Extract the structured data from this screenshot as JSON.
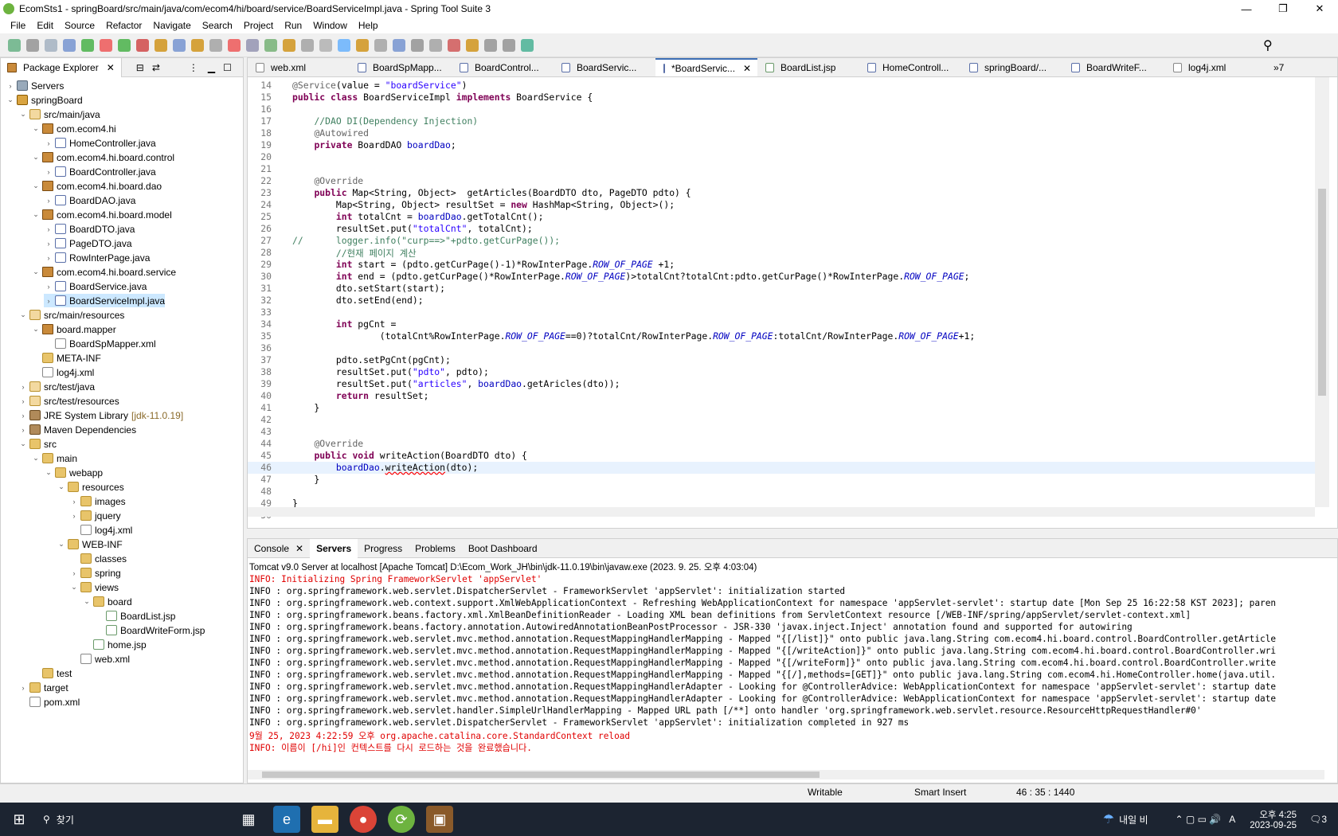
{
  "window": {
    "title": "EcomSts1 - springBoard/src/main/java/com/ecom4/hi/board/service/BoardServiceImpl.java - Spring Tool Suite 3"
  },
  "menu": [
    "File",
    "Edit",
    "Source",
    "Refactor",
    "Navigate",
    "Search",
    "Project",
    "Run",
    "Window",
    "Help"
  ],
  "explorer": {
    "tab": "Package Explorer",
    "items": [
      {
        "label": "Servers",
        "depth": 0,
        "icon": "i-srv",
        "tw": "›"
      },
      {
        "label": "springBoard",
        "depth": 0,
        "icon": "i-proj",
        "tw": "⌄"
      },
      {
        "label": "src/main/java",
        "depth": 1,
        "icon": "i-src",
        "tw": "⌄"
      },
      {
        "label": "com.ecom4.hi",
        "depth": 2,
        "icon": "i-pkg",
        "tw": "⌄"
      },
      {
        "label": "HomeController.java",
        "depth": 3,
        "icon": "i-java",
        "tw": "›"
      },
      {
        "label": "com.ecom4.hi.board.control",
        "depth": 2,
        "icon": "i-pkg",
        "tw": "⌄"
      },
      {
        "label": "BoardController.java",
        "depth": 3,
        "icon": "i-java",
        "tw": "›"
      },
      {
        "label": "com.ecom4.hi.board.dao",
        "depth": 2,
        "icon": "i-pkg",
        "tw": "⌄"
      },
      {
        "label": "BoardDAO.java",
        "depth": 3,
        "icon": "i-java",
        "tw": "›"
      },
      {
        "label": "com.ecom4.hi.board.model",
        "depth": 2,
        "icon": "i-pkg",
        "tw": "⌄"
      },
      {
        "label": "BoardDTO.java",
        "depth": 3,
        "icon": "i-java",
        "tw": "›"
      },
      {
        "label": "PageDTO.java",
        "depth": 3,
        "icon": "i-java",
        "tw": "›"
      },
      {
        "label": "RowInterPage.java",
        "depth": 3,
        "icon": "i-java",
        "tw": "›"
      },
      {
        "label": "com.ecom4.hi.board.service",
        "depth": 2,
        "icon": "i-pkg",
        "tw": "⌄"
      },
      {
        "label": "BoardService.java",
        "depth": 3,
        "icon": "i-java",
        "tw": "›"
      },
      {
        "label": "BoardServiceImpl.java",
        "depth": 3,
        "icon": "i-java",
        "tw": "›",
        "selected": true
      },
      {
        "label": "src/main/resources",
        "depth": 1,
        "icon": "i-src",
        "tw": "⌄"
      },
      {
        "label": "board.mapper",
        "depth": 2,
        "icon": "i-pkg",
        "tw": "⌄"
      },
      {
        "label": "BoardSpMapper.xml",
        "depth": 3,
        "icon": "i-xml",
        "tw": ""
      },
      {
        "label": "META-INF",
        "depth": 2,
        "icon": "i-folder",
        "tw": ""
      },
      {
        "label": "log4j.xml",
        "depth": 2,
        "icon": "i-xml",
        "tw": ""
      },
      {
        "label": "src/test/java",
        "depth": 1,
        "icon": "i-src",
        "tw": "›"
      },
      {
        "label": "src/test/resources",
        "depth": 1,
        "icon": "i-src",
        "tw": "›"
      },
      {
        "label": "JRE System Library",
        "depth": 1,
        "icon": "i-lib",
        "tw": "›",
        "suffix": "[jdk-11.0.19]"
      },
      {
        "label": "Maven Dependencies",
        "depth": 1,
        "icon": "i-lib",
        "tw": "›"
      },
      {
        "label": "src",
        "depth": 1,
        "icon": "i-folder",
        "tw": "⌄"
      },
      {
        "label": "main",
        "depth": 2,
        "icon": "i-folder",
        "tw": "⌄"
      },
      {
        "label": "webapp",
        "depth": 3,
        "icon": "i-folder",
        "tw": "⌄"
      },
      {
        "label": "resources",
        "depth": 4,
        "icon": "i-folder",
        "tw": "⌄"
      },
      {
        "label": "images",
        "depth": 5,
        "icon": "i-folder",
        "tw": "›"
      },
      {
        "label": "jquery",
        "depth": 5,
        "icon": "i-folder",
        "tw": "›"
      },
      {
        "label": "log4j.xml",
        "depth": 5,
        "icon": "i-xml",
        "tw": ""
      },
      {
        "label": "WEB-INF",
        "depth": 4,
        "icon": "i-folder",
        "tw": "⌄"
      },
      {
        "label": "classes",
        "depth": 5,
        "icon": "i-folder",
        "tw": ""
      },
      {
        "label": "spring",
        "depth": 5,
        "icon": "i-folder",
        "tw": "›"
      },
      {
        "label": "views",
        "depth": 5,
        "icon": "i-folder",
        "tw": "⌄"
      },
      {
        "label": "board",
        "depth": 6,
        "icon": "i-folder",
        "tw": "⌄"
      },
      {
        "label": "BoardList.jsp",
        "depth": 7,
        "icon": "i-jsp",
        "tw": ""
      },
      {
        "label": "BoardWriteForm.jsp",
        "depth": 7,
        "icon": "i-jsp",
        "tw": ""
      },
      {
        "label": "home.jsp",
        "depth": 6,
        "icon": "i-jsp",
        "tw": ""
      },
      {
        "label": "web.xml",
        "depth": 5,
        "icon": "i-xml",
        "tw": ""
      },
      {
        "label": "test",
        "depth": 2,
        "icon": "i-folder",
        "tw": ""
      },
      {
        "label": "target",
        "depth": 1,
        "icon": "i-folder",
        "tw": "›"
      },
      {
        "label": "pom.xml",
        "depth": 1,
        "icon": "i-xml",
        "tw": ""
      }
    ]
  },
  "editor": {
    "tabs": [
      "web.xml",
      "BoardSpMapp...",
      "BoardControl...",
      "BoardServic...",
      "*BoardServic...",
      "BoardList.jsp",
      "HomeControll...",
      "springBoard/...",
      "BoardWriteF...",
      "log4j.xml"
    ],
    "active_tab": 4,
    "overflow": "»7",
    "lines": [
      {
        "n": "14",
        "html": "<span class='an'>@Service</span>(value = <span class='st'>\"boardService\"</span>)"
      },
      {
        "n": "15",
        "html": "<span class='kw'>public class</span> BoardServiceImpl <span class='kw'>implements</span> BoardService {"
      },
      {
        "n": "16",
        "html": ""
      },
      {
        "n": "17",
        "html": "    <span class='cm'>//DAO DI(Dependency Injection)</span>"
      },
      {
        "n": "18",
        "html": "    <span class='an'>@Autowired</span>"
      },
      {
        "n": "19",
        "html": "    <span class='kw'>private</span> BoardDAO <span class='fd'>boardDao</span>;"
      },
      {
        "n": "20",
        "html": ""
      },
      {
        "n": "21",
        "html": ""
      },
      {
        "n": "22",
        "html": "    <span class='an'>@Override</span>"
      },
      {
        "n": "23",
        "html": "    <span class='kw'>public</span> Map&lt;String, Object&gt;  getArticles(BoardDTO dto, PageDTO pdto) {"
      },
      {
        "n": "24",
        "html": "        Map&lt;String, Object&gt; resultSet = <span class='kw'>new</span> HashMap&lt;String, Object&gt;();"
      },
      {
        "n": "25",
        "html": "        <span class='kw'>int</span> totalCnt = <span class='fd'>boardDao</span>.getTotalCnt();"
      },
      {
        "n": "26",
        "html": "        resultSet.put(<span class='st'>\"totalCnt\"</span>, totalCnt);"
      },
      {
        "n": "27",
        "html": "<span class='cm'>//      logger.info(\"curp==>\"+pdto.getCurPage());</span>"
      },
      {
        "n": "28",
        "html": "        <span class='cm'>//현재 페이지 계산</span>"
      },
      {
        "n": "29",
        "html": "        <span class='kw'>int</span> start = (pdto.getCurPage()-1)*RowInterPage.<span class='sf'>ROW_OF_PAGE</span> +1;"
      },
      {
        "n": "30",
        "html": "        <span class='kw'>int</span> end = (pdto.getCurPage()*RowInterPage.<span class='sf'>ROW_OF_PAGE</span>)&gt;totalCnt?totalCnt:pdto.getCurPage()*RowInterPage.<span class='sf'>ROW_OF_PAGE</span>;"
      },
      {
        "n": "31",
        "html": "        dto.setStart(start);"
      },
      {
        "n": "32",
        "html": "        dto.setEnd(end);"
      },
      {
        "n": "33",
        "html": ""
      },
      {
        "n": "34",
        "html": "        <span class='kw'>int</span> pgCnt ="
      },
      {
        "n": "35",
        "html": "                (totalCnt%RowInterPage.<span class='sf'>ROW_OF_PAGE</span>==0)?totalCnt/RowInterPage.<span class='sf'>ROW_OF_PAGE</span>:totalCnt/RowInterPage.<span class='sf'>ROW_OF_PAGE</span>+1;"
      },
      {
        "n": "36",
        "html": ""
      },
      {
        "n": "37",
        "html": "        pdto.setPgCnt(pgCnt);"
      },
      {
        "n": "38",
        "html": "        resultSet.put(<span class='st'>\"pdto\"</span>, pdto);"
      },
      {
        "n": "39",
        "html": "        resultSet.put(<span class='st'>\"articles\"</span>, <span class='fd'>boardDao</span>.getAricles(dto));"
      },
      {
        "n": "40",
        "html": "        <span class='kw'>return</span> resultSet;"
      },
      {
        "n": "41",
        "html": "    }"
      },
      {
        "n": "42",
        "html": ""
      },
      {
        "n": "43",
        "html": ""
      },
      {
        "n": "44",
        "html": "    <span class='an'>@Override</span>"
      },
      {
        "n": "45",
        "html": "    <span class='kw'>public void</span> writeAction(BoardDTO dto) {"
      },
      {
        "n": "46",
        "html": "        <span class='fd'>boardDao</span>.<span style='text-decoration:underline wavy red'>writeAction</span>(dto);",
        "current": true
      },
      {
        "n": "47",
        "html": "    }"
      },
      {
        "n": "48",
        "html": ""
      },
      {
        "n": "49",
        "html": "}"
      },
      {
        "n": "50",
        "html": ""
      }
    ]
  },
  "console": {
    "tabs": [
      "Console",
      "Servers",
      "Progress",
      "Problems",
      "Boot Dashboard"
    ],
    "server_line": "Tomcat v9.0 Server at localhost [Apache Tomcat] D:\\Ecom_Work_JH\\bin\\jdk-11.0.19\\bin\\javaw.exe  (2023. 9. 25. 오후 4:03:04)",
    "log": [
      {
        "t": "INFO: Initializing Spring FrameworkServlet 'appServlet'",
        "red": true
      },
      {
        "t": "INFO : org.springframework.web.servlet.DispatcherServlet - FrameworkServlet 'appServlet': initialization started"
      },
      {
        "t": "INFO : org.springframework.web.context.support.XmlWebApplicationContext - Refreshing WebApplicationContext for namespace 'appServlet-servlet': startup date [Mon Sep 25 16:22:58 KST 2023]; paren"
      },
      {
        "t": "INFO : org.springframework.beans.factory.xml.XmlBeanDefinitionReader - Loading XML bean definitions from ServletContext resource [/WEB-INF/spring/appServlet/servlet-context.xml]"
      },
      {
        "t": "INFO : org.springframework.beans.factory.annotation.AutowiredAnnotationBeanPostProcessor - JSR-330 'javax.inject.Inject' annotation found and supported for autowiring"
      },
      {
        "t": "INFO : org.springframework.web.servlet.mvc.method.annotation.RequestMappingHandlerMapping - Mapped \"{[/list]}\" onto public java.lang.String com.ecom4.hi.board.control.BoardController.getArticle"
      },
      {
        "t": "INFO : org.springframework.web.servlet.mvc.method.annotation.RequestMappingHandlerMapping - Mapped \"{[/writeAction]}\" onto public java.lang.String com.ecom4.hi.board.control.BoardController.wri"
      },
      {
        "t": "INFO : org.springframework.web.servlet.mvc.method.annotation.RequestMappingHandlerMapping - Mapped \"{[/writeForm]}\" onto public java.lang.String com.ecom4.hi.board.control.BoardController.write"
      },
      {
        "t": "INFO : org.springframework.web.servlet.mvc.method.annotation.RequestMappingHandlerMapping - Mapped \"{[/],methods=[GET]}\" onto public java.lang.String com.ecom4.hi.HomeController.home(java.util."
      },
      {
        "t": "INFO : org.springframework.web.servlet.mvc.method.annotation.RequestMappingHandlerAdapter - Looking for @ControllerAdvice: WebApplicationContext for namespace 'appServlet-servlet': startup date"
      },
      {
        "t": "INFO : org.springframework.web.servlet.mvc.method.annotation.RequestMappingHandlerAdapter - Looking for @ControllerAdvice: WebApplicationContext for namespace 'appServlet-servlet': startup date"
      },
      {
        "t": "INFO : org.springframework.web.servlet.handler.SimpleUrlHandlerMapping - Mapped URL path [/**] onto handler 'org.springframework.web.servlet.resource.ResourceHttpRequestHandler#0'"
      },
      {
        "t": "INFO : org.springframework.web.servlet.DispatcherServlet - FrameworkServlet 'appServlet': initialization completed in 927 ms"
      },
      {
        "t": "9월 25, 2023 4:22:59 오후 org.apache.catalina.core.StandardContext reload",
        "red": true
      },
      {
        "t": "INFO: 이름이 [/hi]인 컨텍스트를 다시 로드하는 것을 완료했습니다.",
        "red": true
      }
    ]
  },
  "status": {
    "writable": "Writable",
    "insert": "Smart Insert",
    "position": "46 : 35 : 1440"
  },
  "taskbar": {
    "search": "찾기",
    "weather": "내일 비",
    "time": "오후 4:25",
    "date": "2023-09-25",
    "ime": "A",
    "notif": "3"
  }
}
